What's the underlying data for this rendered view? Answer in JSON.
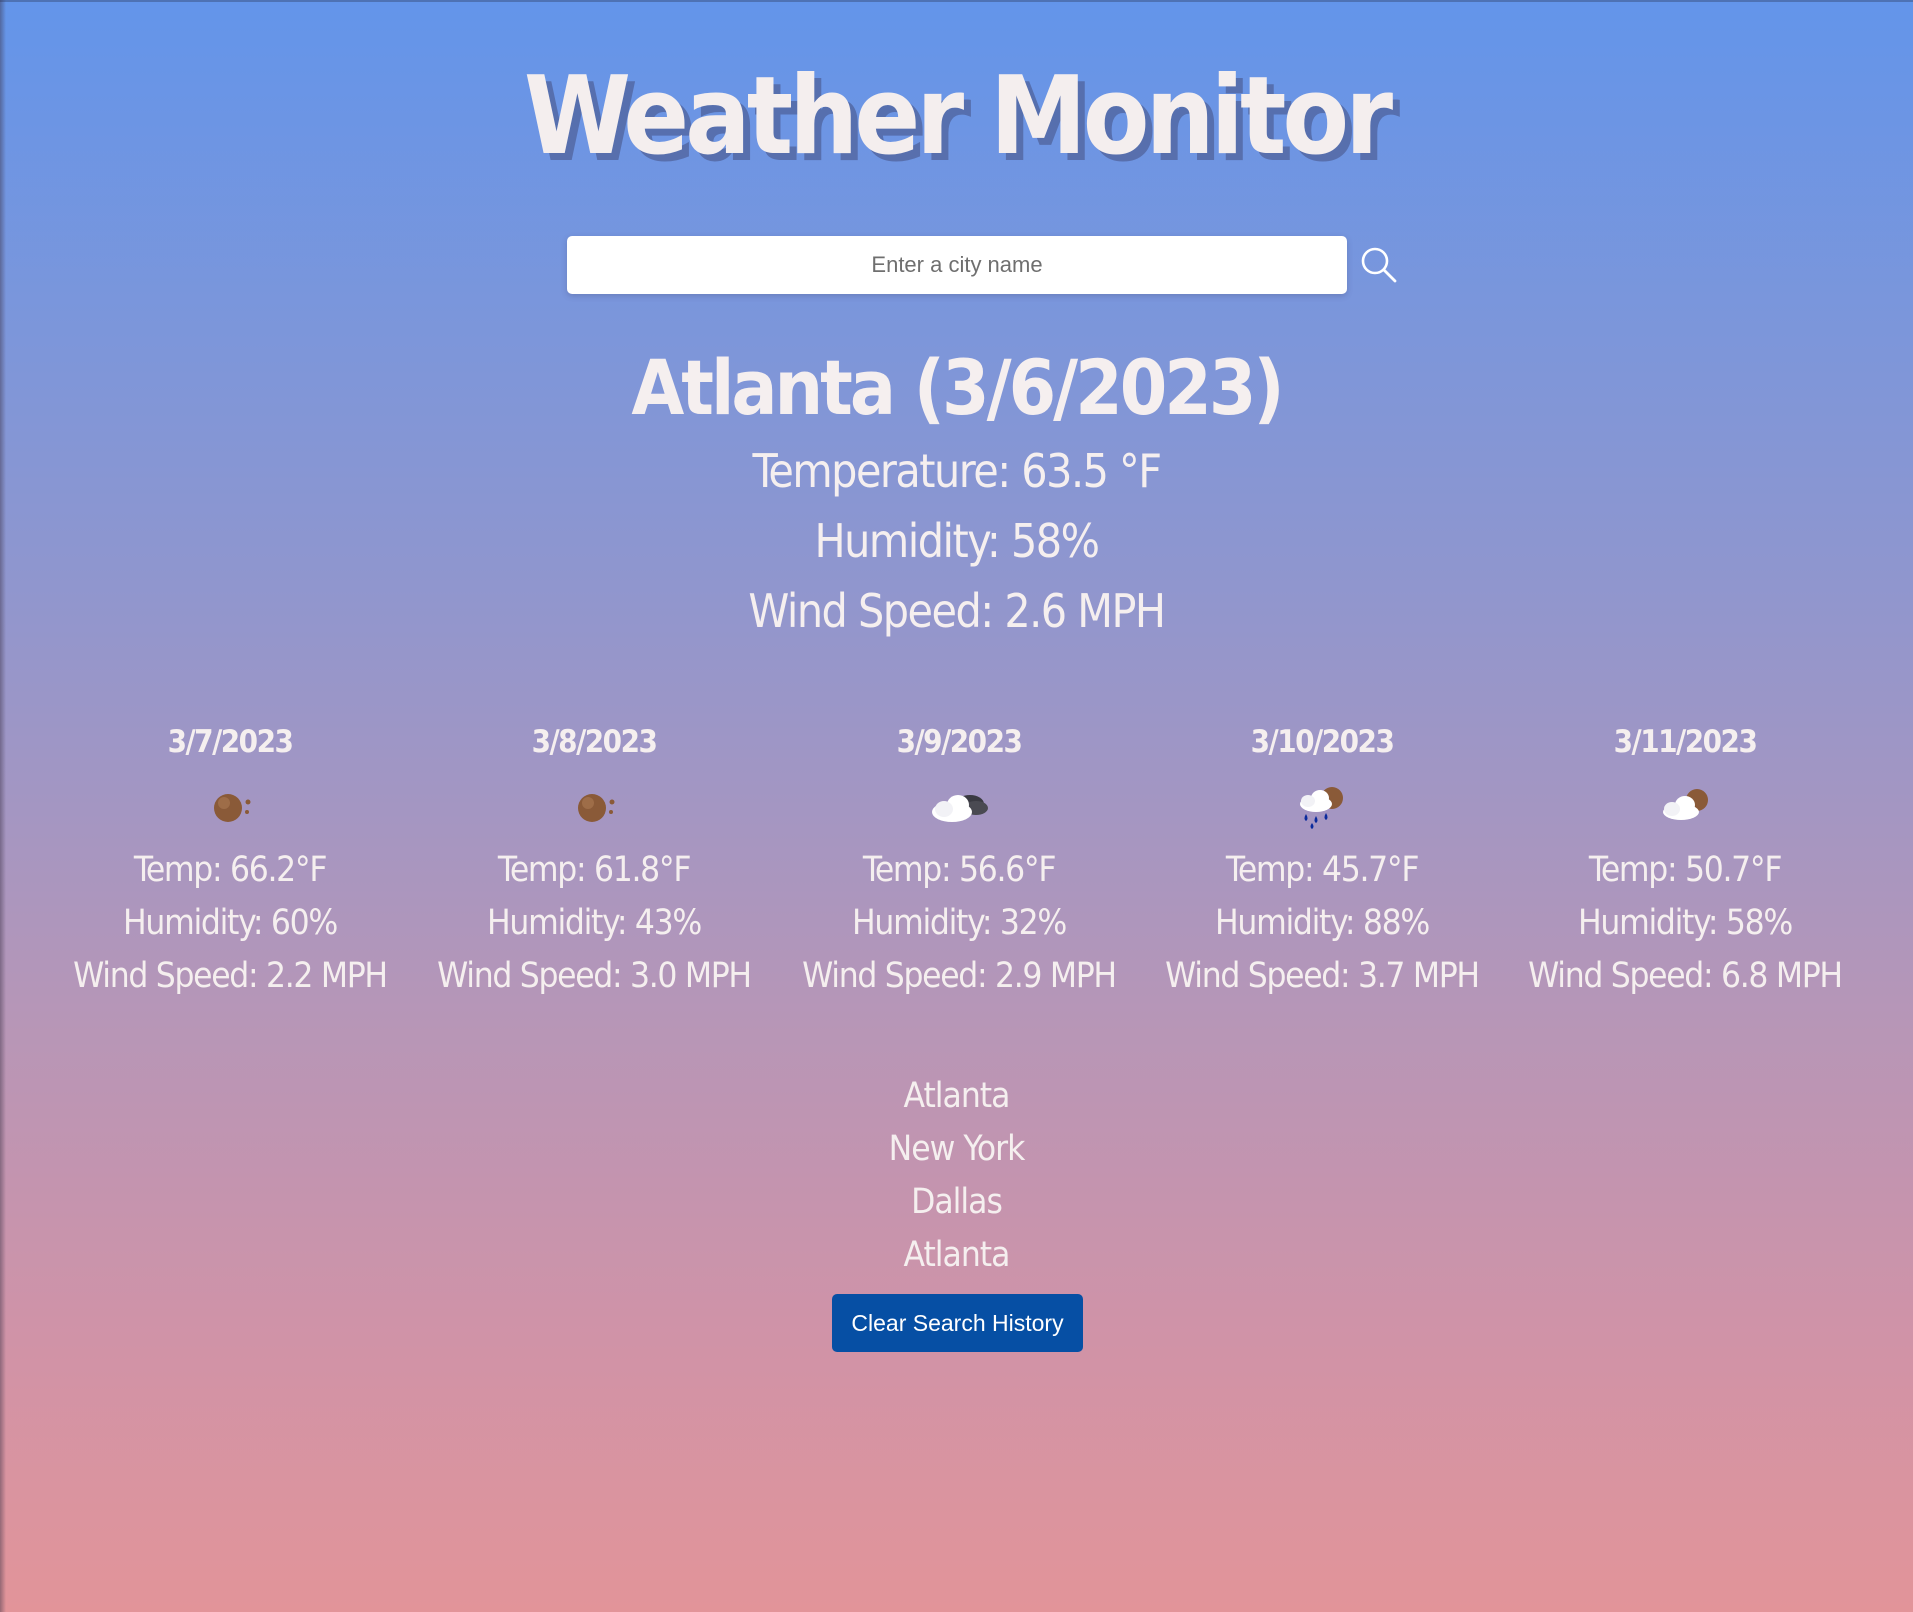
{
  "app": {
    "title": "Weather Monitor"
  },
  "search": {
    "placeholder": "Enter a city name",
    "value": "",
    "button_icon": "search-icon"
  },
  "current": {
    "heading": "Atlanta (3/6/2023)",
    "temperature": "Temperature: 63.5 °F",
    "humidity": "Humidity: 58%",
    "wind": "Wind Speed: 2.6 MPH"
  },
  "forecast": [
    {
      "date": "3/7/2023",
      "icon": "clear-night-icon",
      "temp": "Temp: 66.2°F",
      "humidity": "Humidity: 60%",
      "wind": "Wind Speed: 2.2 MPH"
    },
    {
      "date": "3/8/2023",
      "icon": "clear-night-icon",
      "temp": "Temp: 61.8°F",
      "humidity": "Humidity: 43%",
      "wind": "Wind Speed: 3.0 MPH"
    },
    {
      "date": "3/9/2023",
      "icon": "cloudy-icon",
      "temp": "Temp: 56.6°F",
      "humidity": "Humidity: 32%",
      "wind": "Wind Speed: 2.9 MPH"
    },
    {
      "date": "3/10/2023",
      "icon": "rain-icon",
      "temp": "Temp: 45.7°F",
      "humidity": "Humidity: 88%",
      "wind": "Wind Speed: 3.7 MPH"
    },
    {
      "date": "3/11/2023",
      "icon": "partly-cloudy-icon",
      "temp": "Temp: 50.7°F",
      "humidity": "Humidity: 58%",
      "wind": "Wind Speed: 6.8 MPH"
    }
  ],
  "history": {
    "items": [
      "Atlanta",
      "New York",
      "Dallas",
      "Atlanta"
    ],
    "clear_label": "Clear Search History"
  },
  "colors": {
    "gradient_top": "#6395ea",
    "gradient_bottom": "#e29499",
    "text": "#f5efef",
    "button": "#064fa4"
  }
}
